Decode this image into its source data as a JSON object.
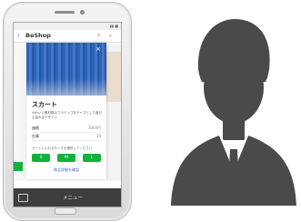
{
  "app": {
    "title": "BeShop",
    "back_icon": "chevron-left-icon",
    "search_icon": "search-icon",
    "menu_icon": "chevron-down-icon"
  },
  "product": {
    "name": "スカート",
    "description": "かわいい素材感のフラミンゴをテーマとした遊び心溢れるデザイン",
    "price_label": "価格",
    "price_value": "3000円",
    "stock_label": "在庫",
    "stock_value": "10",
    "size_hint": "カートに入れるサイズを選択してください",
    "sizes": [
      "S",
      "M",
      "L"
    ],
    "detail_link": "商品詳細を確認"
  },
  "bottom_bar": {
    "keyboard_icon": "keyboard-icon",
    "menu_label": "メニュー"
  },
  "colors": {
    "accent": "#11b33b",
    "skirt": "#2f63b7",
    "person": "#4a4a4a",
    "bottombar": "#3e3e3e"
  },
  "illustration": {
    "icon": "businessman-icon"
  }
}
